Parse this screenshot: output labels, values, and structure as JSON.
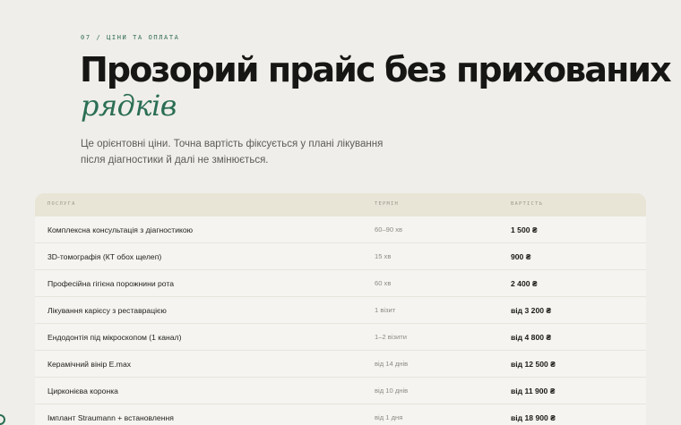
{
  "section": {
    "eyebrow": "07 / ЦІНИ ТА ОПЛАТА",
    "headline": "Прозорий прайс без прихованих",
    "headline_accent": "рядків",
    "lead": "Це орієнтовні ціни. Точна вартість фіксується у плані лікування після діагностики й далі не змінюється."
  },
  "colors": {
    "accent": "#2b6e55",
    "table_header_bg": "#e8e5d7"
  },
  "table": {
    "headers": {
      "service": "ПОСЛУГА",
      "term": "ТЕРМІН",
      "price": "ВАРТІСТЬ"
    },
    "rows": [
      {
        "service": "Комплексна консультація з діагностикою",
        "term": "60–90 хв",
        "price": "1 500 ₴"
      },
      {
        "service": "3D-томографія (КТ обох щелеп)",
        "term": "15 хв",
        "price": "900 ₴"
      },
      {
        "service": "Професійна гігієна порожнини рота",
        "term": "60 хв",
        "price": "2 400 ₴"
      },
      {
        "service": "Лікування карієсу з реставрацією",
        "term": "1 візит",
        "price": "від 3 200 ₴"
      },
      {
        "service": "Ендодонтія під мікроскопом (1 канал)",
        "term": "1–2 візити",
        "price": "від 4 800 ₴"
      },
      {
        "service": "Керамічний вінір E.max",
        "term": "від 14 днів",
        "price": "від 12 500 ₴"
      },
      {
        "service": "Цирконієва коронка",
        "term": "від 10 днів",
        "price": "від 11 900 ₴"
      },
      {
        "service": "Імплант Straumann + встановлення",
        "term": "від 1 дня",
        "price": "від 18 900 ₴"
      }
    ]
  }
}
